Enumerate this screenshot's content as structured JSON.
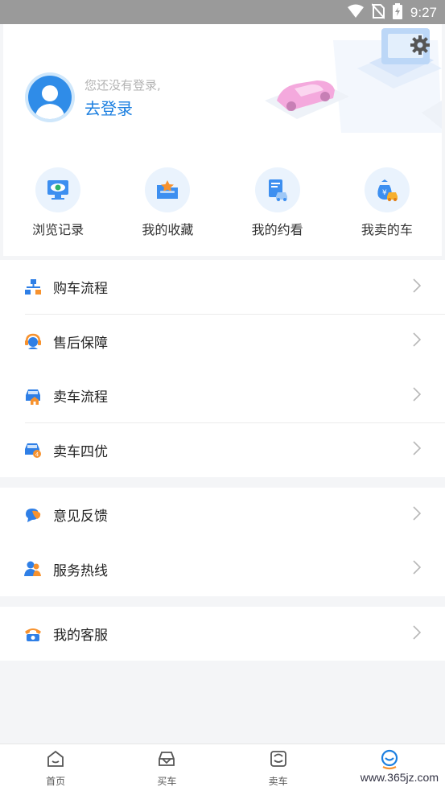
{
  "status_bar": {
    "time": "9:27"
  },
  "profile": {
    "hint": "您还没有登录,",
    "login_label": "去登录"
  },
  "shortcuts": [
    {
      "label": "浏览记录",
      "icon": "monitor-eye-icon"
    },
    {
      "label": "我的收藏",
      "icon": "folder-star-icon"
    },
    {
      "label": "我的约看",
      "icon": "document-car-icon"
    },
    {
      "label": "我卖的车",
      "icon": "money-bag-car-icon"
    }
  ],
  "menu_group_1": [
    {
      "label": "购车流程",
      "icon": "flowchart-icon"
    },
    {
      "label": "售后保障",
      "icon": "headset-icon"
    },
    {
      "label": "卖车流程",
      "icon": "car-home-icon"
    },
    {
      "label": "卖车四优",
      "icon": "car-badge-icon"
    }
  ],
  "menu_group_2": [
    {
      "label": "意见反馈",
      "icon": "chat-bubble-icon"
    },
    {
      "label": "服务热线",
      "icon": "people-icon"
    }
  ],
  "menu_group_3": [
    {
      "label": "我的客服",
      "icon": "telephone-icon"
    }
  ],
  "tab_bar": [
    {
      "label": "首页",
      "icon": "home-icon"
    },
    {
      "label": "买车",
      "icon": "buy-car-icon"
    },
    {
      "label": "卖车",
      "icon": "sell-car-icon"
    },
    {
      "label": "",
      "icon": "smile-user-icon",
      "active": true
    }
  ],
  "watermark": "www.365jz.com",
  "colors": {
    "accent": "#1b7fe0",
    "status_bar": "#9a9a9a",
    "background": "#f4f5f7"
  }
}
